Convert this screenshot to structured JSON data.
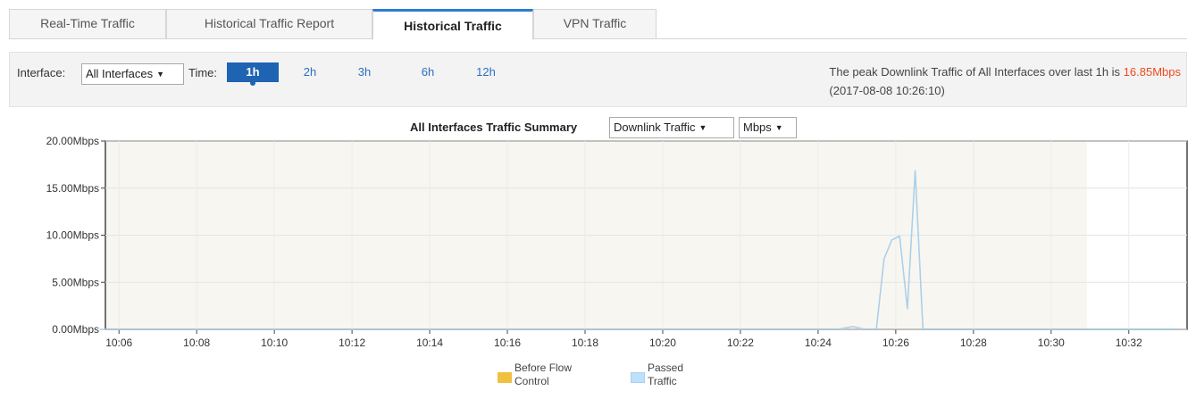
{
  "tabs": [
    {
      "label": "Real-Time Traffic",
      "active": false
    },
    {
      "label": "Historical Traffic Report",
      "active": false
    },
    {
      "label": "Historical Traffic",
      "active": true
    },
    {
      "label": "VPN Traffic",
      "active": false
    }
  ],
  "filter": {
    "interface_label": "Interface:",
    "interface_value": "All Interfaces",
    "time_label": "Time:",
    "time_options": [
      "1h",
      "2h",
      "3h",
      "6h",
      "12h"
    ],
    "time_selected": "1h",
    "peak_text": "The peak Downlink Traffic of All Interfaces over last 1h is ",
    "peak_value": "16.85Mbps",
    "peak_time": "(2017-08-08 10:26:10)"
  },
  "chart_header": {
    "title": "All Interfaces Traffic Summary",
    "direction_value": "Downlink Traffic",
    "unit_value": "Mbps"
  },
  "chart_data": {
    "type": "line",
    "title": "All Interfaces Traffic Summary",
    "ylabel": "",
    "xlabel": "",
    "y_tick_labels": [
      "0.00Mbps",
      "5.00Mbps",
      "10.00Mbps",
      "15.00Mbps",
      "20.00Mbps"
    ],
    "ylim": [
      0,
      20
    ],
    "x_tick_labels": [
      "10:06",
      "10:08",
      "10:10",
      "10:12",
      "10:14",
      "10:16",
      "10:18",
      "10:20",
      "10:22",
      "10:24",
      "10:26",
      "10:28",
      "10:30",
      "10:32"
    ],
    "grid": true,
    "legend_position": "bottom",
    "series": [
      {
        "name": "Before Flow Control",
        "color": "#f0c040",
        "points": [
          [
            "10:05.5",
            0
          ],
          [
            "10:24.5",
            0
          ],
          [
            "10:24.9",
            0.3
          ],
          [
            "10:25.2",
            0
          ],
          [
            "10:25.5",
            0
          ],
          [
            "10:25.7",
            7.5
          ],
          [
            "10:25.9",
            9.5
          ],
          [
            "10:26.1",
            9.9
          ],
          [
            "10:26.3",
            2.2
          ],
          [
            "10:26.5",
            16.85
          ],
          [
            "10:26.7",
            0
          ],
          [
            "10:33.3",
            0
          ]
        ]
      },
      {
        "name": "Passed Traffic",
        "color": "#a8d0f0",
        "points": [
          [
            "10:05.5",
            0
          ],
          [
            "10:24.5",
            0
          ],
          [
            "10:24.9",
            0.3
          ],
          [
            "10:25.2",
            0
          ],
          [
            "10:25.5",
            0
          ],
          [
            "10:25.7",
            7.5
          ],
          [
            "10:25.9",
            9.5
          ],
          [
            "10:26.1",
            9.9
          ],
          [
            "10:26.3",
            2.2
          ],
          [
            "10:26.5",
            16.85
          ],
          [
            "10:26.7",
            0
          ],
          [
            "10:33.3",
            0
          ]
        ]
      }
    ],
    "legend_labels": [
      [
        "Before Flow",
        "Control"
      ],
      [
        "Passed",
        "Traffic"
      ]
    ]
  }
}
